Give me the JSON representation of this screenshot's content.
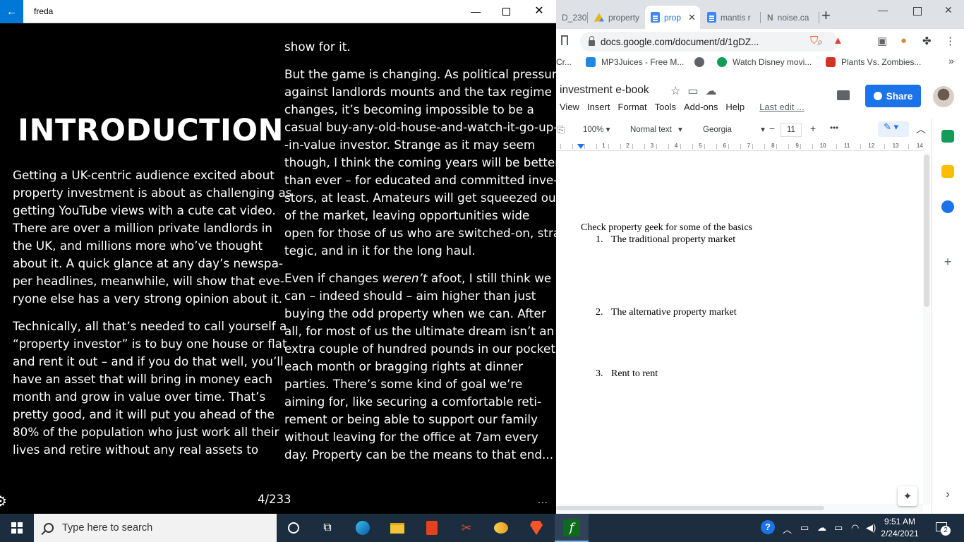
{
  "chrome": {
    "tabs": [
      {
        "label": "D_230"
      },
      {
        "label": "property"
      },
      {
        "label": "prop",
        "active": true
      },
      {
        "label": "mantis r"
      },
      {
        "label": "noise.ca"
      }
    ],
    "new_tab": "+",
    "url": "docs.google.com/document/d/1gDZ...",
    "bookmarks": [
      "Cr...",
      "MP3Juices - Free M...",
      "Watch Disney movi...",
      "Plants Vs. Zombies..."
    ],
    "bookmarks_more": "»"
  },
  "docs": {
    "title": "investment e-book",
    "menus": [
      "View",
      "Insert",
      "Format",
      "Tools",
      "Add-ons",
      "Help"
    ],
    "last_edit": "Last edit ...",
    "share_label": "Share",
    "toolbar": {
      "zoom": "100%",
      "style": "Normal text",
      "font": "Georgia",
      "font_size": "11",
      "minus": "−",
      "plus": "+",
      "more": "•••"
    },
    "ruler_numbers": [
      "1",
      "2",
      "3",
      "4",
      "5",
      "6",
      "7",
      "8",
      "9",
      "10",
      "11",
      "12",
      "13",
      "14"
    ],
    "body": {
      "intro": "Check property geek for some of the basics",
      "items": [
        {
          "num": "1.",
          "text": "The traditional property market"
        },
        {
          "num": "2.",
          "text": "The alternative property market"
        },
        {
          "num": "3.",
          "text": "Rent to rent"
        }
      ]
    }
  },
  "reader": {
    "app_name": "freda",
    "heading": "INTRODUCTION",
    "left_column": [
      [
        "Getting a UK-centric audience excited about",
        "property investment is about as challenging as",
        "getting YouTube views with a cute cat video.",
        "There are over a million private landlords in",
        "the UK, and millions more who’ve thought",
        "about it. A quick glance at any day’s newspa-",
        "per headlines, meanwhile, will show that eve-",
        "ryone else has a very strong opinion about it."
      ],
      [
        "Technically, all that’s needed to call yourself a",
        "“property investor” is to buy one house or flat",
        "and rent it out – and if you do that well, you’ll",
        "have an asset that will bring in money each",
        "month and grow in value over time. That’s",
        "pretty good, and it will put you ahead of the",
        "80% of the population who just work all their",
        "lives and retire without any real assets to"
      ]
    ],
    "right_column": {
      "carry_line": "show for it.",
      "para1": [
        "But the game is changing. As political pressure",
        "against landlords mounts and the tax regime",
        "changes, it’s becoming impossible to be a",
        "casual buy-any-old-house-and-watch-it-go-up-",
        "-in-value investor.  Strange as it may seem",
        "though, I think the coming years will be better",
        "than ever – for educated and committed inve-",
        "stors, at least. Amateurs will get squeezed out",
        "of the market, leaving opportunities wide",
        "open for those of us who are switched-on, stra-",
        "tegic, and in it for the long haul."
      ],
      "para2_first_pre": "Even if changes ",
      "para2_first_em": "weren’t",
      "para2_first_post": " afoot, I still think we",
      "para2": [
        "can – indeed should – aim higher than just",
        "buying the odd property when we can. After",
        "all, for most of us the ultimate dream isn’t an",
        "extra couple of hundred pounds in our pocket",
        "each month or bragging rights at dinner",
        "parties. There’s some kind of goal we’re",
        "aiming for, like securing a comfortable reti-",
        "rement or being able to support our family",
        "without leaving for the office at 7am every",
        "day. Property can be the means to that end..."
      ]
    },
    "page_indicator": "4/233",
    "more_label": "..."
  },
  "taskbar": {
    "search_placeholder": "Type here to search",
    "time": "9:51 AM",
    "date": "2/24/2021",
    "notification_count": "2"
  },
  "colors": {
    "reader_bg": "#000000",
    "accent_blue": "#0078d7",
    "share_blue": "#1a73e8",
    "taskbar": "#1c2d3f"
  }
}
